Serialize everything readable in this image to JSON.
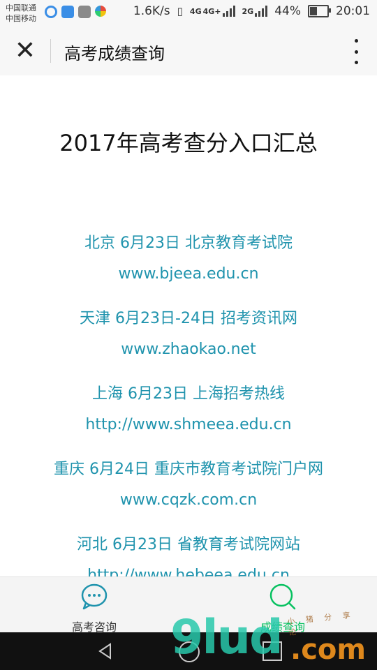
{
  "status_bar": {
    "carrier_1": "中国联通",
    "carrier_2": "中国移动",
    "net_speed": "1.6K/s",
    "net_4g": "4G",
    "net_4g_plus": "4G+",
    "net_2g": "2G",
    "battery_percent": "44%",
    "battery_level": 0.44,
    "time": "20:01",
    "app_icons": [
      "refresh-icon",
      "location-icon",
      "gallery-icon",
      "photos-icon"
    ]
  },
  "title_bar": {
    "close_label": "✕",
    "title": "高考成绩查询"
  },
  "content": {
    "heading": "2017年高考查分入口汇总",
    "entries": [
      {
        "info": "北京 6月23日 北京教育考试院",
        "url": "www.bjeea.edu.cn"
      },
      {
        "info": "天津 6月23日-24日 招考资讯网",
        "url": "www.zhaokao.net"
      },
      {
        "info": "上海 6月23日 上海招考热线",
        "url": "http://www.shmeea.edu.cn"
      },
      {
        "info": "重庆 6月24日 重庆市教育考试院门户网",
        "url": "www.cqzk.com.cn"
      },
      {
        "info": "河北 6月23日 省教育考试院网站",
        "url": "http://www.hebeea.edu.cn"
      }
    ]
  },
  "tab_bar": {
    "tabs": [
      {
        "label": "高考咨询",
        "icon": "chat-bubble-icon"
      },
      {
        "label": "成绩查询",
        "icon": "search-icon",
        "active": true
      }
    ]
  },
  "watermark": {
    "brand": "9lud",
    "domain": ".com",
    "small": "小 猪 分 享 论"
  },
  "colors": {
    "link": "#1f93ad",
    "active_tab": "#07c160",
    "text": "#111111"
  }
}
